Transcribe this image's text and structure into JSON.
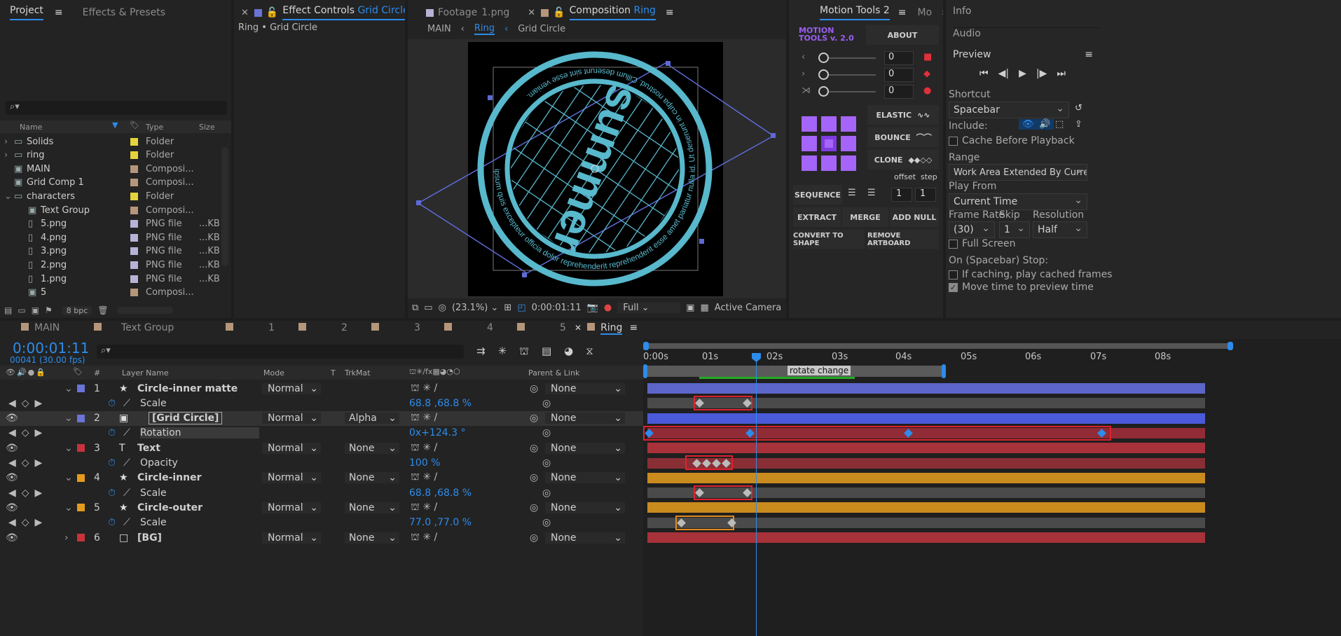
{
  "project": {
    "tabs": [
      {
        "label": "Project"
      },
      {
        "label": "Effects & Presets"
      }
    ],
    "search_placeholder": "",
    "columns": {
      "name": "Name",
      "type": "Type",
      "size": "Size"
    },
    "items": [
      {
        "name": "Solids",
        "type": "Folder",
        "size": "",
        "color": "#e5d33d"
      },
      {
        "name": "ring",
        "type": "Folder",
        "size": "",
        "color": "#e5d33d"
      },
      {
        "name": "MAIN",
        "type": "Composi...",
        "size": "",
        "color": "#b5967a"
      },
      {
        "name": "Grid Comp 1",
        "type": "Composi...",
        "size": "",
        "color": "#b5967a"
      },
      {
        "name": "characters",
        "type": "Folder",
        "size": "",
        "color": "#e5d33d"
      },
      {
        "name": "Text Group",
        "type": "Composi...",
        "size": "",
        "color": "#b5967a"
      },
      {
        "name": "5.png",
        "type": "PNG file",
        "size": "...KB",
        "color": "#b6b3d6"
      },
      {
        "name": "4.png",
        "type": "PNG file",
        "size": "...KB",
        "color": "#b6b3d6"
      },
      {
        "name": "3.png",
        "type": "PNG file",
        "size": "...KB",
        "color": "#b6b3d6"
      },
      {
        "name": "2.png",
        "type": "PNG file",
        "size": "...KB",
        "color": "#b6b3d6"
      },
      {
        "name": "1.png",
        "type": "PNG file",
        "size": "...KB",
        "color": "#b6b3d6"
      },
      {
        "name": "5",
        "type": "Composi...",
        "size": "",
        "color": "#b5967a"
      }
    ],
    "bpc": "8 bpc"
  },
  "effect_controls": {
    "tab_label": "Effect Controls",
    "tab_target": "Grid Circle",
    "breadcrumb": "Ring • Grid Circle"
  },
  "viewer": {
    "tabs": [
      {
        "label": "Footage"
      },
      {
        "label": "Composition"
      }
    ],
    "footage_name": "1.png",
    "comp_name": "Ring",
    "nav": {
      "main": "MAIN",
      "ring": "Ring",
      "grid": "Grid Circle"
    },
    "zoom": "(23.1%)",
    "timecode": "0:00:01:11",
    "resolution": "Full",
    "camera": "Active Camera",
    "artwork": {
      "text_large": "summer",
      "ring_text": "ipsum quis excepteur officia dolor reprehenderit reprehenderit esse amet pariatur nulla id. Ut deserunt in culpa nostrud. Cillum deserunt sint esse veniam."
    }
  },
  "motion_tools": {
    "tab": "Motion Tools 2",
    "tab2": "Mo",
    "logo_line1": "MOTION",
    "logo_line2": "TOOLS v. 2.0",
    "about": "ABOUT",
    "sliders": [
      {
        "value": "0"
      },
      {
        "value": "0"
      },
      {
        "value": "0"
      }
    ],
    "elastic": "ELASTIC",
    "bounce": "BOUNCE",
    "clone": "CLONE",
    "offset": "offset",
    "step": "step",
    "sequence": "SEQUENCE",
    "offset_val": "1",
    "step_val": "1",
    "extract": "EXTRACT",
    "merge": "MERGE",
    "add_null": "ADD NULL",
    "convert": "CONVERT TO SHAPE",
    "remove_artboard": "REMOVE ARTBOARD"
  },
  "right_panel": {
    "info": "Info",
    "audio": "Audio",
    "preview": "Preview",
    "shortcut_label": "Shortcut",
    "shortcut": "Spacebar",
    "include": "Include:",
    "cache_before": "Cache Before Playback",
    "range_label": "Range",
    "range": "Work Area Extended By Current...",
    "play_from_label": "Play From",
    "play_from": "Current Time",
    "frame_rate_label": "Frame Rate",
    "skip_label": "Skip",
    "resolution_label": "Resolution",
    "frame_rate": "(30)",
    "skip": "1",
    "resolution": "Half",
    "full_screen": "Full Screen",
    "stop_label": "On (Spacebar) Stop:",
    "if_caching": "If caching, play cached frames",
    "move_time": "Move time to preview time",
    "move_time_checked": true
  },
  "timeline": {
    "tabs": [
      {
        "label": "MAIN"
      },
      {
        "label": "Text Group"
      },
      {
        "label": "1"
      },
      {
        "label": "2"
      },
      {
        "label": "3"
      },
      {
        "label": "4"
      },
      {
        "label": "5"
      },
      {
        "label": "Ring"
      }
    ],
    "timecode": "0:00:01:11",
    "frames": "00041 (30.00 fps)",
    "columns": {
      "name": "Layer Name",
      "mode": "Mode",
      "t": "T",
      "trkmat": "TrkMat",
      "parent": "Parent & Link"
    },
    "ruler": [
      "0:00s",
      "01s",
      "02s",
      "03s",
      "04s",
      "05s",
      "06s",
      "07s",
      "08s"
    ],
    "marker": "rotate change",
    "layers": [
      {
        "num": "1",
        "name": "Circle-inner matte",
        "mode": "Normal",
        "trkmat": "",
        "parent": "None",
        "color": "#6a73d6",
        "prop": "Scale",
        "value": "68.8 ,68.8 %"
      },
      {
        "num": "2",
        "name": "[Grid Circle]",
        "mode": "Normal",
        "trkmat": "Alpha",
        "parent": "None",
        "color": "#6a73d6",
        "prop": "Rotation",
        "value": "0x+124.3 °"
      },
      {
        "num": "3",
        "name": "Text",
        "mode": "Normal",
        "trkmat": "None",
        "parent": "None",
        "color": "#c8333b",
        "prop": "Opacity",
        "value": "100 %"
      },
      {
        "num": "4",
        "name": "Circle-inner",
        "mode": "Normal",
        "trkmat": "None",
        "parent": "None",
        "color": "#e39a1d",
        "prop": "Scale",
        "value": "68.8 ,68.8 %"
      },
      {
        "num": "5",
        "name": "Circle-outer",
        "mode": "Normal",
        "trkmat": "None",
        "parent": "None",
        "color": "#e39a1d",
        "prop": "Scale",
        "value": "77.0 ,77.0 %"
      },
      {
        "num": "6",
        "name": "[BG]",
        "mode": "Normal",
        "trkmat": "None",
        "parent": "None",
        "color": "#c8333b"
      }
    ]
  }
}
